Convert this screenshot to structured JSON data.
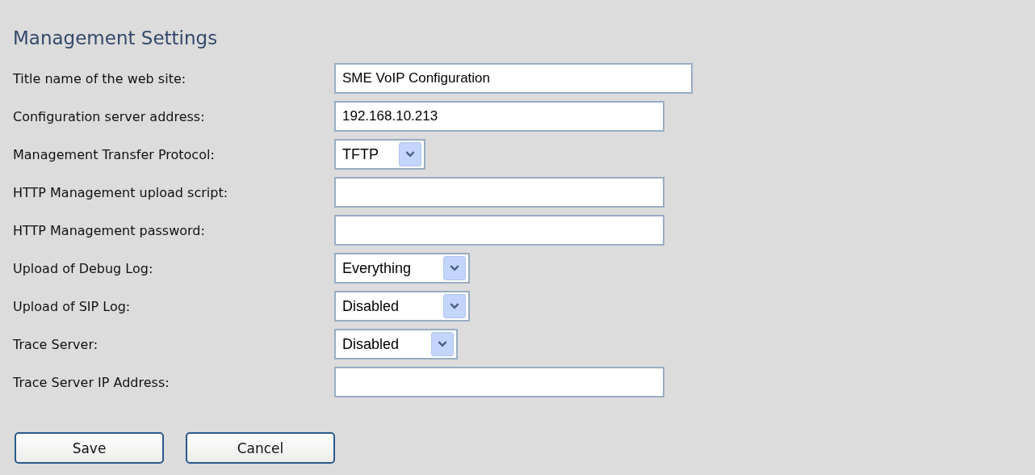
{
  "title": "Management Settings",
  "fields": [
    {
      "label": "Title name of the web site:",
      "kind": "text",
      "value": "SME VoIP Configuration"
    },
    {
      "label": "Configuration server address:",
      "kind": "text",
      "value": "192.168.10.213"
    },
    {
      "label": "Management Transfer Protocol:",
      "kind": "select",
      "value": "TFTP"
    },
    {
      "label": "HTTP Management upload script:",
      "kind": "text"
    },
    {
      "label": "HTTP Management password:",
      "kind": "text"
    },
    {
      "label": "Upload of Debug Log:",
      "kind": "select",
      "value": "Everything"
    },
    {
      "label": "Upload of SIP Log:",
      "kind": "select",
      "value": "Disabled"
    },
    {
      "label": "Trace Server:",
      "kind": "select",
      "value": "Disabled"
    },
    {
      "label": "Trace Server IP Address:",
      "kind": "text"
    }
  ],
  "buttons": [
    "Save",
    "Cancel"
  ]
}
